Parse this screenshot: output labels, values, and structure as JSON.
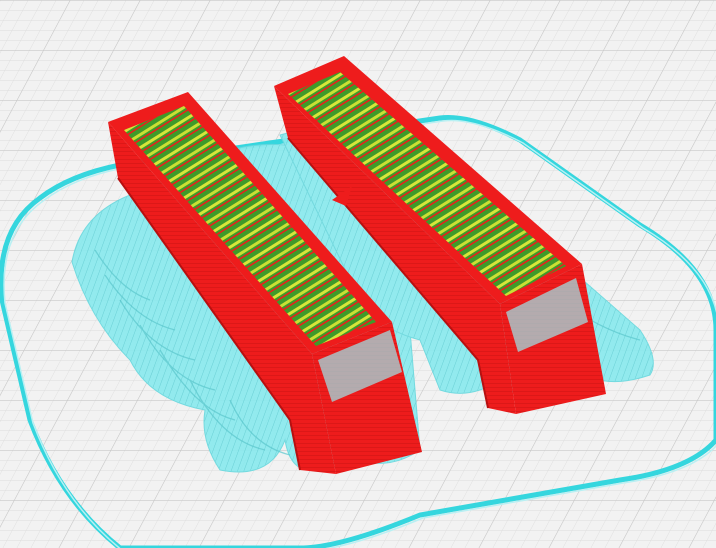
{
  "scene": {
    "view": "layer-preview",
    "colors": {
      "background": "#f2f2f2",
      "grid_minor": "#dcdcdc",
      "grid_major": "#c8c8c8",
      "skirt": "#35d6de",
      "skirt_edge": "#9fe8ec",
      "support": "#7fe6ea",
      "support_shade": "#5cc9cf",
      "wall": "#ee1c1c",
      "wall_dark": "#c41414",
      "infill": "#3f9a2a",
      "infill_highlight": "#d6e63a"
    },
    "objects": [
      {
        "kind": "bridge-part",
        "label": "left-part"
      },
      {
        "kind": "bridge-part",
        "label": "right-part"
      }
    ]
  }
}
